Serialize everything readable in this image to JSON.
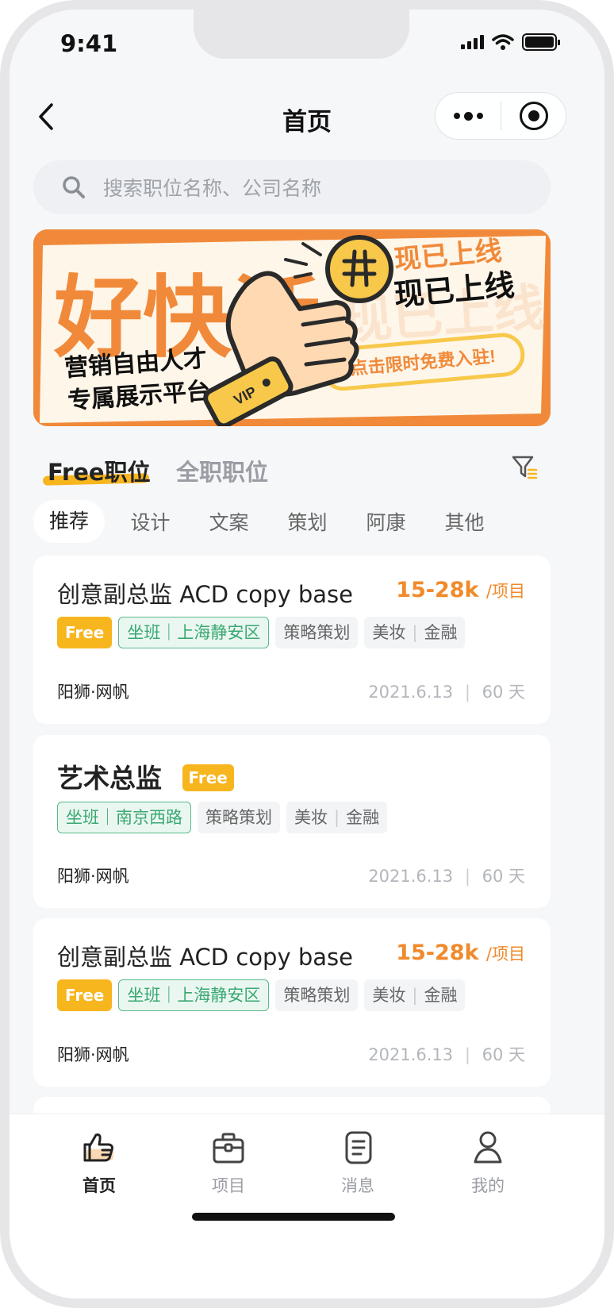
{
  "status_bar": {
    "time": "9:41"
  },
  "nav": {
    "title": "首页"
  },
  "search": {
    "placeholder": "搜索职位名称、公司名称"
  },
  "banner": {
    "headline": "好快活",
    "line1": "营销自由人才",
    "line2": "专属展示平台",
    "tag_top": "现已上线",
    "tag_faded": "现已上线",
    "cta": "点击限时免费入驻!",
    "badge": "VIP",
    "colors": {
      "orange": "#f08a3a",
      "yellow": "#f7c84a",
      "cream": "#fff4e6"
    }
  },
  "job_tabs": [
    {
      "label": "Free职位",
      "active": true
    },
    {
      "label": "全职职位",
      "active": false
    }
  ],
  "categories": [
    {
      "label": "推荐",
      "active": true
    },
    {
      "label": "设计",
      "active": false
    },
    {
      "label": "文案",
      "active": false
    },
    {
      "label": "策划",
      "active": false
    },
    {
      "label": "阿康",
      "active": false
    },
    {
      "label": "其他",
      "active": false
    }
  ],
  "jobs": [
    {
      "title": "创意副总监 ACD copy base",
      "salary": "15-28k",
      "salary_unit": "/项目",
      "free_label": "Free",
      "location": "坐班｜上海静安区",
      "tag1": "策略策划",
      "tag2a": "美妆",
      "tag2b": "金融",
      "company": "阳狮·网帆",
      "meta_date": "2021.6.13",
      "meta_days": "60 天"
    },
    {
      "title": "艺术总监",
      "free_label": "Free",
      "location": "坐班｜南京西路",
      "tag1": "策略策划",
      "tag2a": "美妆",
      "tag2b": "金融",
      "company": "阳狮·网帆",
      "meta_date": "2021.6.13",
      "meta_days": "60 天"
    },
    {
      "title": "创意副总监 ACD copy base",
      "salary": "15-28k",
      "salary_unit": "/项目",
      "free_label": "Free",
      "location": "坐班｜上海静安区",
      "tag1": "策略策划",
      "tag2a": "美妆",
      "tag2b": "金融",
      "company": "阳狮·网帆",
      "meta_date": "2021.6.13",
      "meta_days": "60 天"
    }
  ],
  "tabbar": [
    {
      "label": "首页",
      "icon": "thumbs-up-icon",
      "active": true
    },
    {
      "label": "项目",
      "icon": "briefcase-icon",
      "active": false
    },
    {
      "label": "消息",
      "icon": "document-icon",
      "active": false
    },
    {
      "label": "我的",
      "icon": "person-icon",
      "active": false
    }
  ],
  "colors": {
    "accent": "#f08a2a",
    "free": "#f7b51e",
    "location_green": "#3aa872"
  }
}
